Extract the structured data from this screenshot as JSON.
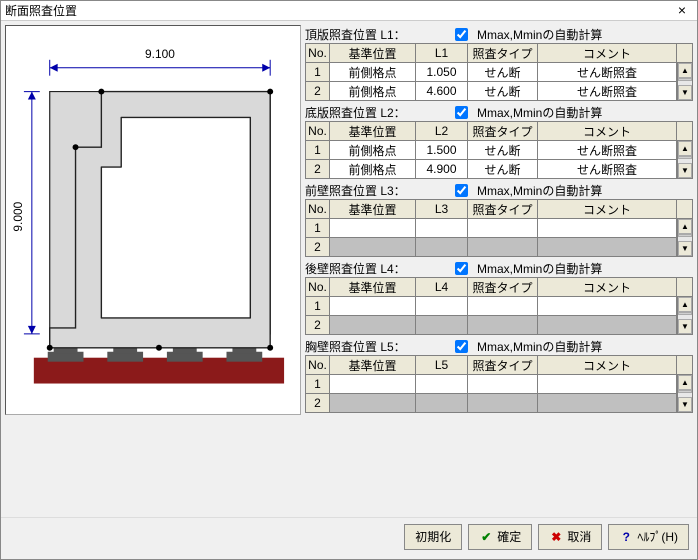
{
  "window": {
    "title": "断面照査位置"
  },
  "diagram": {
    "dim_top": "9.100",
    "dim_left": "9.000"
  },
  "columns": {
    "no": "No.",
    "ref": "基準位置",
    "type": "照査タイプ",
    "comment": "コメント"
  },
  "auto_label": "Mmax,Mminの自動計算",
  "sections": [
    {
      "label": "頂版照査位置  L1：",
      "col": "L1",
      "auto": true,
      "rows": [
        {
          "no": "1",
          "ref": "前側格点",
          "val": "1.050",
          "type": "せん断",
          "comment": "せん断照査"
        },
        {
          "no": "2",
          "ref": "前側格点",
          "val": "4.600",
          "type": "せん断",
          "comment": "せん断照査"
        }
      ],
      "empty": 0
    },
    {
      "label": "底版照査位置  L2：",
      "col": "L2",
      "auto": true,
      "rows": [
        {
          "no": "1",
          "ref": "前側格点",
          "val": "1.500",
          "type": "せん断",
          "comment": "せん断照査"
        },
        {
          "no": "2",
          "ref": "前側格点",
          "val": "4.900",
          "type": "せん断",
          "comment": "せん断照査"
        }
      ],
      "empty": 0
    },
    {
      "label": "前壁照査位置  L3：",
      "col": "L3",
      "auto": true,
      "rows": [
        {
          "no": "1",
          "ref": "",
          "val": "",
          "type": "",
          "comment": ""
        }
      ],
      "empty": 1
    },
    {
      "label": "後壁照査位置  L4：",
      "col": "L4",
      "auto": true,
      "rows": [
        {
          "no": "1",
          "ref": "",
          "val": "",
          "type": "",
          "comment": ""
        }
      ],
      "empty": 1
    },
    {
      "label": "胸壁照査位置  L5：",
      "col": "L5",
      "auto": true,
      "rows": [
        {
          "no": "1",
          "ref": "",
          "val": "",
          "type": "",
          "comment": ""
        }
      ],
      "empty": 1
    }
  ],
  "buttons": {
    "init": "初期化",
    "ok": "確定",
    "cancel": "取消",
    "help": "ﾍﾙﾌﾟ(H)"
  }
}
